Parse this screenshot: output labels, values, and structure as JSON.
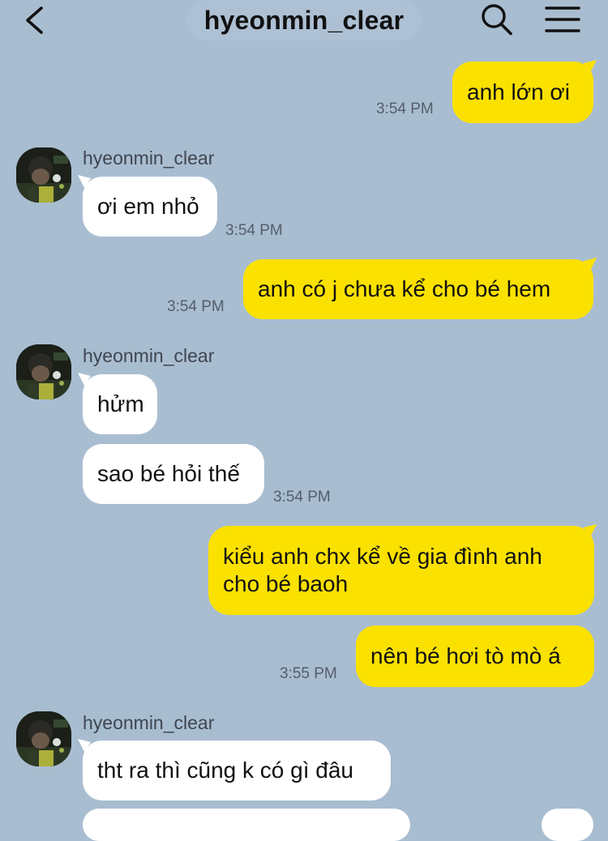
{
  "header": {
    "title": "hyeonmin_clear",
    "back_icon": "chevron-left-icon",
    "search_icon": "search-icon",
    "menu_icon": "hamburger-menu-icon"
  },
  "colors": {
    "background": "#a9bdd1",
    "my_bubble": "#fbe100",
    "their_bubble": "#ffffff"
  },
  "messages": [
    {
      "from": "me",
      "text": "anh lớn ơi",
      "time": "3:54 PM"
    },
    {
      "from": "hyeonmin_clear",
      "name": "hyeonmin_clear",
      "text": "ơi em nhỏ",
      "time": "3:54 PM"
    },
    {
      "from": "me",
      "text": "anh có j chưa kể cho bé hem",
      "time": "3:54 PM"
    },
    {
      "from": "hyeonmin_clear",
      "name": "hyeonmin_clear",
      "text": "hửm"
    },
    {
      "from": "hyeonmin_clear",
      "text": "sao bé hỏi thế",
      "time": "3:54 PM"
    },
    {
      "from": "me",
      "lines": [
        "kiểu anh chx kể về gia đình anh",
        "cho bé baoh"
      ]
    },
    {
      "from": "me",
      "text": "nên bé hơi tò mò á",
      "time": "3:55 PM"
    },
    {
      "from": "hyeonmin_clear",
      "name": "hyeonmin_clear",
      "text": "tht ra thì cũng k có gì đâu"
    }
  ]
}
